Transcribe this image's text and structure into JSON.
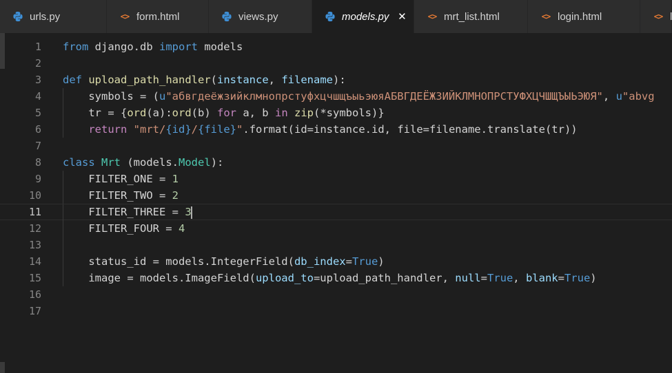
{
  "tabs": [
    {
      "label": "urls.py",
      "icon": "python-icon",
      "active": false
    },
    {
      "label": "form.html",
      "icon": "html-icon",
      "active": false
    },
    {
      "label": "views.py",
      "icon": "python-icon",
      "active": false
    },
    {
      "label": "models.py",
      "icon": "python-icon",
      "active": true
    },
    {
      "label": "mrt_list.html",
      "icon": "html-icon",
      "active": false
    },
    {
      "label": "login.html",
      "icon": "html-icon",
      "active": false
    },
    {
      "label": "log",
      "icon": "html-icon",
      "active": false
    }
  ],
  "close_symbol": "✕",
  "colors": {
    "keyword": "#569cd6",
    "control": "#c586c0",
    "function": "#dcdcaa",
    "class": "#4ec9b0",
    "parameter": "#9cdcfe",
    "string": "#ce9178",
    "number": "#b5cea8",
    "python_icon": "#3e8fd6",
    "html_icon": "#e37933"
  },
  "editor": {
    "current_line": 11,
    "lines": [
      {
        "n": "1",
        "tokens": [
          [
            "k",
            "from"
          ],
          [
            "tx",
            " django.db "
          ],
          [
            "k",
            "import"
          ],
          [
            "tx",
            " models"
          ]
        ]
      },
      {
        "n": "2",
        "tokens": []
      },
      {
        "n": "3",
        "tokens": [
          [
            "k",
            "def"
          ],
          [
            "tx",
            " "
          ],
          [
            "fn",
            "upload_path_handler"
          ],
          [
            "tx",
            "("
          ],
          [
            "prm",
            "instance"
          ],
          [
            "tx",
            ", "
          ],
          [
            "prm",
            "filename"
          ],
          [
            "tx",
            "):"
          ]
        ]
      },
      {
        "n": "4",
        "tokens": [
          [
            "tx",
            "    symbols = ("
          ],
          [
            "k",
            "u"
          ],
          [
            "str",
            "\"абвгдеёжзийклмнопрстуфхцчшщъыьэюяАБВГДЕЁЖЗИЙКЛМНОПРСТУФХЦЧШЩЪЫЬЭЮЯ\""
          ],
          [
            "tx",
            ", "
          ],
          [
            "k",
            "u"
          ],
          [
            "str",
            "\"abvg"
          ]
        ]
      },
      {
        "n": "5",
        "tokens": [
          [
            "tx",
            "    tr = {"
          ],
          [
            "fn",
            "ord"
          ],
          [
            "tx",
            "(a):"
          ],
          [
            "fn",
            "ord"
          ],
          [
            "tx",
            "(b) "
          ],
          [
            "ctl",
            "for"
          ],
          [
            "tx",
            " a, b "
          ],
          [
            "ctl",
            "in"
          ],
          [
            "tx",
            " "
          ],
          [
            "fn",
            "zip"
          ],
          [
            "tx",
            "(*symbols)}"
          ]
        ]
      },
      {
        "n": "6",
        "tokens": [
          [
            "tx",
            "    "
          ],
          [
            "ctl",
            "return"
          ],
          [
            "tx",
            " "
          ],
          [
            "str",
            "\"mrt/"
          ],
          [
            "k",
            "{id}"
          ],
          [
            "str",
            "/"
          ],
          [
            "k",
            "{file}"
          ],
          [
            "str",
            "\""
          ],
          [
            "tx",
            ".format(id=instance.id, file=filename.translate(tr))"
          ]
        ]
      },
      {
        "n": "7",
        "tokens": []
      },
      {
        "n": "8",
        "tokens": [
          [
            "k",
            "class"
          ],
          [
            "tx",
            " "
          ],
          [
            "cls",
            "Mrt"
          ],
          [
            "tx",
            " (models."
          ],
          [
            "cls",
            "Model"
          ],
          [
            "tx",
            "):"
          ]
        ]
      },
      {
        "n": "9",
        "tokens": [
          [
            "tx",
            "    FILTER_ONE = "
          ],
          [
            "num",
            "1"
          ]
        ]
      },
      {
        "n": "10",
        "tokens": [
          [
            "tx",
            "    FILTER_TWO = "
          ],
          [
            "num",
            "2"
          ]
        ]
      },
      {
        "n": "11",
        "tokens": [
          [
            "tx",
            "    FILTER_THREE = "
          ],
          [
            "num",
            "3"
          ],
          [
            "cursor",
            ""
          ]
        ]
      },
      {
        "n": "12",
        "tokens": [
          [
            "tx",
            "    FILTER_FOUR = "
          ],
          [
            "num",
            "4"
          ]
        ]
      },
      {
        "n": "13",
        "tokens": []
      },
      {
        "n": "14",
        "tokens": [
          [
            "tx",
            "    status_id = models.IntegerField("
          ],
          [
            "prm",
            "db_index"
          ],
          [
            "tx",
            "="
          ],
          [
            "k",
            "True"
          ],
          [
            "tx",
            ")"
          ]
        ]
      },
      {
        "n": "15",
        "tokens": [
          [
            "tx",
            "    image = models.ImageField("
          ],
          [
            "prm",
            "upload_to"
          ],
          [
            "tx",
            "=upload_path_handler, "
          ],
          [
            "prm",
            "null"
          ],
          [
            "tx",
            "="
          ],
          [
            "k",
            "True"
          ],
          [
            "tx",
            ", "
          ],
          [
            "prm",
            "blank"
          ],
          [
            "tx",
            "="
          ],
          [
            "k",
            "True"
          ],
          [
            "tx",
            ")"
          ]
        ]
      },
      {
        "n": "16",
        "tokens": []
      },
      {
        "n": "17",
        "tokens": []
      }
    ]
  }
}
